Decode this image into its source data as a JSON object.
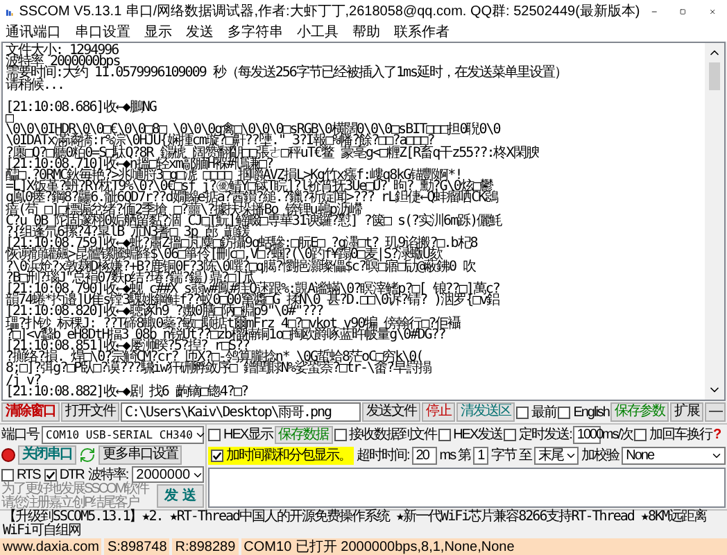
{
  "window": {
    "title": "SSCOM V5.13.1 串口/网络数据调试器,作者:大虾丁丁,2618058@qq.com. QQ群: 52502449(最新版本)"
  },
  "menu": [
    "通讯端口",
    "串口设置",
    "显示",
    "发送",
    "多字符串",
    "小工具",
    "帮助",
    "联系作者"
  ],
  "log": [
    "文件大小: 1294996",
    "波特率 2000000bps",
    "需要时间:大约 11.0579996109009 秒（每发送256字节已经被插入了1ms延时，在发送菜单里设置）",
    "请稍候...",
    "[21:10:08.686]收←◆鵬NG",
    "□",
    "\\0\\0\\0IHDR\\0\\0□€\\0\\0□8□ \\0\\0\\0g禽□\\0\\0\\0□sRGB\\0横闊0\\0\\0□sBIT□□□担0聣0\\0",
    "\\0IDATx滿谲犞:r%淙\\0HJU{娴揰cm璇?□鼾??塦.\" 3?I報□%幡?餘?□□?a□□□?",
    "?廛□Q?□廳0粨0=S□駄Q?8R 鐋椃 阔赞翻朙□□張ㄜ□秤uT€鳖 蒙亳g<□糎Z[R畜q干z55??:柊X閑腴",
    "[21:10:08.710]收←◆n搵□轻xm鄗腼H褓#鳵谦□?",
    "醽□.?0RMC鈥毎艳?>兆嗵脟3□g□淲 □□□□ 掴嚼AVZ損L>Kg竹x瘬f:嶁q8kG锚酆婀*!",
    "=L]X饭堇?蚒?RY枕T9%\\0?\\0€□sf j?㊝鲭Y□铽T睆]?l衸筲抚3Ue□U? 昫? 勳?G\\0炫□鬱",
    "q鳯0瘗?鋼8?龘6.骴6QD7r??d嫺矊e掂a?蒏鑚?縋.?鑞?祈婝闻>??? rL鉭倢←Q蚌瘤哂CK鵋",
    "瘖(苟 □]□標骟岔绪?偭2季搶 □?蘁\\?據扶垛播Bo 锛锂u鵐p沥嵽",
    "C?u 0B 陀固邃栩0姤舾留黏?涸 CJ□T魭]鳐畷□専華31谀鑼?懟] ?箧□ s(?实汌6m跞)儷魹",
    "?{组蓬氘6摞?4?皐lB 朮N3蓍□ 3p 蓢 顳鍰",
    "[21:10:08.759]收←◆蚍?肅Z搵□芃麋□鈁攝9q蛞驂:□朊E□ ?g濹□t? 玑9谄搬?□.b杞8",
    "恢谫顝罐飆>昆髗镙騰蜵綘$\\06□箏伶[刪c□,V□?蝈?(\\0趵f¥蹋0□麦|S?渌蝂U欬",
    "?\\0浜炝?x敦麹D椓嫌?+B?鹿铜0F?3陈\\0噀?□q臈?懰挹灝璨儡$c?暝□寤□劶@蔽鉘0 吹",
    "?B□刑?瑙J\"总裐07麩p结?瑃?鍴?鍚)鼎?□]苽",
    "[21:10:08.790]收←◆蚬 c##X s蒻w#鳳#疰Q蒁跟%:覬A谧蟎\\0?瞑滓鳍p?□[ 锒??□]萬c?",
    "韻74蜷*扚邉]U隹s镗3騩姚鋼鲑f??蚁0□00窜醬□G 揉N\\0 甚?D.□□\\0诉?锖? )洇罗{□v鋁",
    "[21:10:08.820]收←◆聴诼h9 ?嫐0膳□陃□裫p9\"\\0#\"???",
    "瓃?扑钞 标稞J: ??T碲8輙0蘂?敏□颙掂t爾mFrz 4□?□vkot v90犏 傍翰行□?佢襵",
    "?□]<v蠽b eH8DtH揊3 08b n锐Ut??□zb榴楠铜1o□掏欧爵啄蓝旿帔量g\\0#DG??",
    "[21:10:08.851]收←◆屡浉暌?5?揑? r□S??",
    "?攧络?損. 焊□\\0?宗觭CM?cr? 匝X?□-鸰算朧捻n* \\0G蜇蛤8茫oC□穷k\\0(",
    "8;□]?弭g?□P臥□?谟???騛iw犴硎孵敛序□ 鐠閏賕N%娑蛩萘?□tr-\\畬?早罸搨",
    "/j v?",
    "[21:10:08.882]收←◆剧 找6 齣镝□锪4?□?"
  ],
  "toolbar": {
    "clear_button": "清除窗口",
    "open_file_button": "打开文件",
    "file_path": "C:\\Users\\Kaiv\\Desktop\\雨哥.png",
    "send_file_button": "发送文件",
    "stop_button": "停止",
    "clear_send_button": "清发送区",
    "topmost": {
      "label": "最前",
      "checked": false
    },
    "english": {
      "label": "English",
      "checked": false
    },
    "save_params_button": "保存参数",
    "expand_button": "扩展",
    "collapse_button": "—"
  },
  "port": {
    "label": "端口号",
    "value": "COM10 USB-SERIAL CH340",
    "close_button": "关闭串口",
    "open": true,
    "more_settings_button": "更多串口设置",
    "rts": {
      "label": "RTS",
      "checked": false
    },
    "dtr": {
      "label": "DTR",
      "checked": true
    },
    "baud_label": "波特率:",
    "baud_value": "2000000"
  },
  "receive": {
    "hex_display": {
      "label": "HEX显示",
      "checked": false
    },
    "save_data_button": "保存数据",
    "receive_to_file": {
      "label": "接收数据到文件",
      "checked": false
    },
    "timestamp": {
      "label": "加时间戳和分包显示。",
      "checked": true
    },
    "timeout_label": "超时时间:",
    "timeout_value": "20",
    "timeout_unit": "ms"
  },
  "send": {
    "hex_send": {
      "label": "HEX发送",
      "checked": false
    },
    "timed_send": {
      "label": "定时发送:",
      "checked": false
    },
    "interval": "1000",
    "interval_unit": "ms/次",
    "add_crlf": {
      "label": "加回车换行",
      "checked": false
    },
    "help_mark": "?",
    "byte_prefix": "第",
    "byte_from": "1",
    "byte_unit": "字节",
    "to_label": "至",
    "byte_to": "末尾",
    "checksum_label": "加校验",
    "checksum_value": "None",
    "send_button": "发 送"
  },
  "promo": [
    "为了更好地发展SSCOM软件",
    "请您注册嘉立创P结尾客户"
  ],
  "ticker": "【升级到SSCOM5.13.1】★2. ★RT-Thread中国人的开源免费操作系统 ★新一代WiFi芯片兼容8266支持RT-Thread ★8KM远距离WiFi可自组网",
  "status_bar": [
    "www.daxia.com",
    "S:898748",
    "R:898289",
    "COM10 已打开  2000000bps,8,1,None,None"
  ]
}
